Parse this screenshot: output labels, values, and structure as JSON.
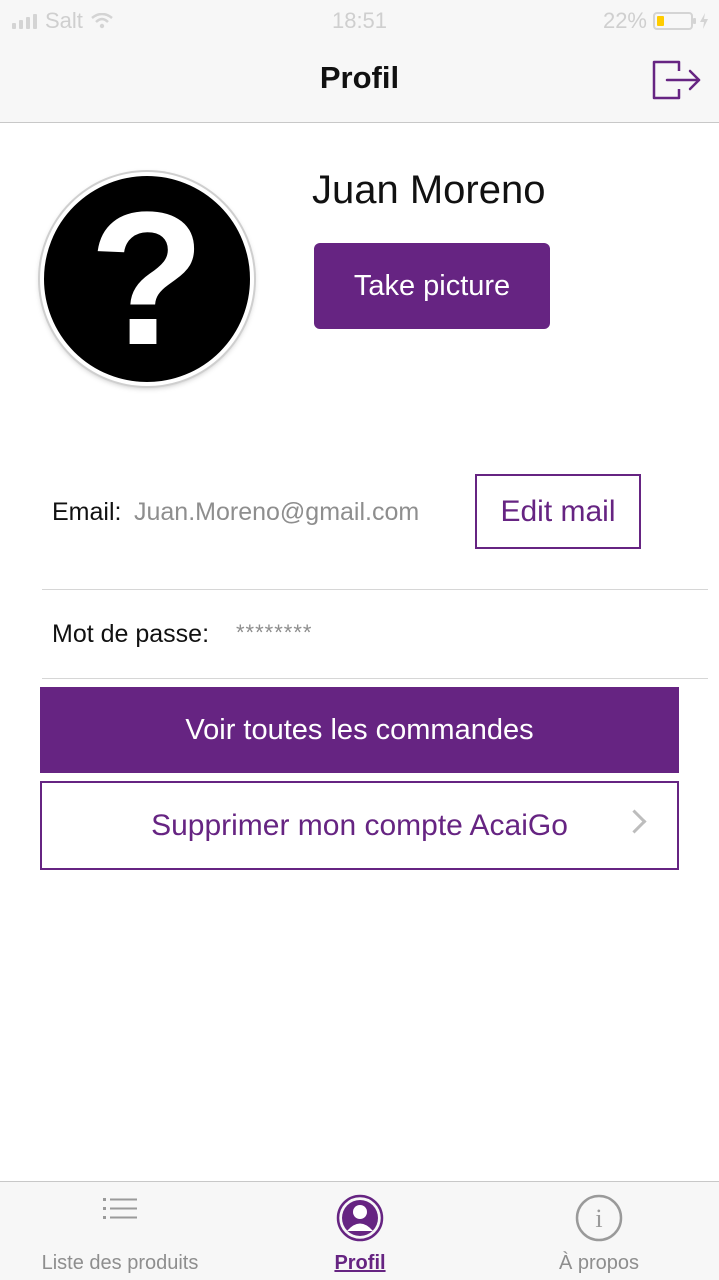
{
  "status_bar": {
    "carrier": "Salt",
    "time": "18:51",
    "battery": "22%",
    "battery_level": 0.22
  },
  "nav": {
    "title": "Profil",
    "logout_icon": "logout-icon"
  },
  "profile": {
    "avatar_icon": "question-mark-icon",
    "avatar_glyph": "?",
    "name": "Juan Moreno",
    "take_picture_label": "Take picture"
  },
  "email": {
    "label": "Email:",
    "value": "Juan.Moreno@gmail.com",
    "edit_label": "Edit mail"
  },
  "password": {
    "label": "Mot de passe:",
    "value": "********"
  },
  "actions": {
    "orders_label": "Voir toutes les commandes",
    "delete_label": "Supprimer mon compte AcaiGo"
  },
  "tabs": [
    {
      "label": "Liste des produits",
      "icon": "list-icon",
      "active": false
    },
    {
      "label": "Profil",
      "icon": "user-icon",
      "active": true
    },
    {
      "label": "À propos",
      "icon": "info-icon",
      "active": false
    }
  ],
  "colors": {
    "accent": "#662482",
    "muted_text": "#8e8e8e",
    "bar_background": "#f7f7f7"
  }
}
